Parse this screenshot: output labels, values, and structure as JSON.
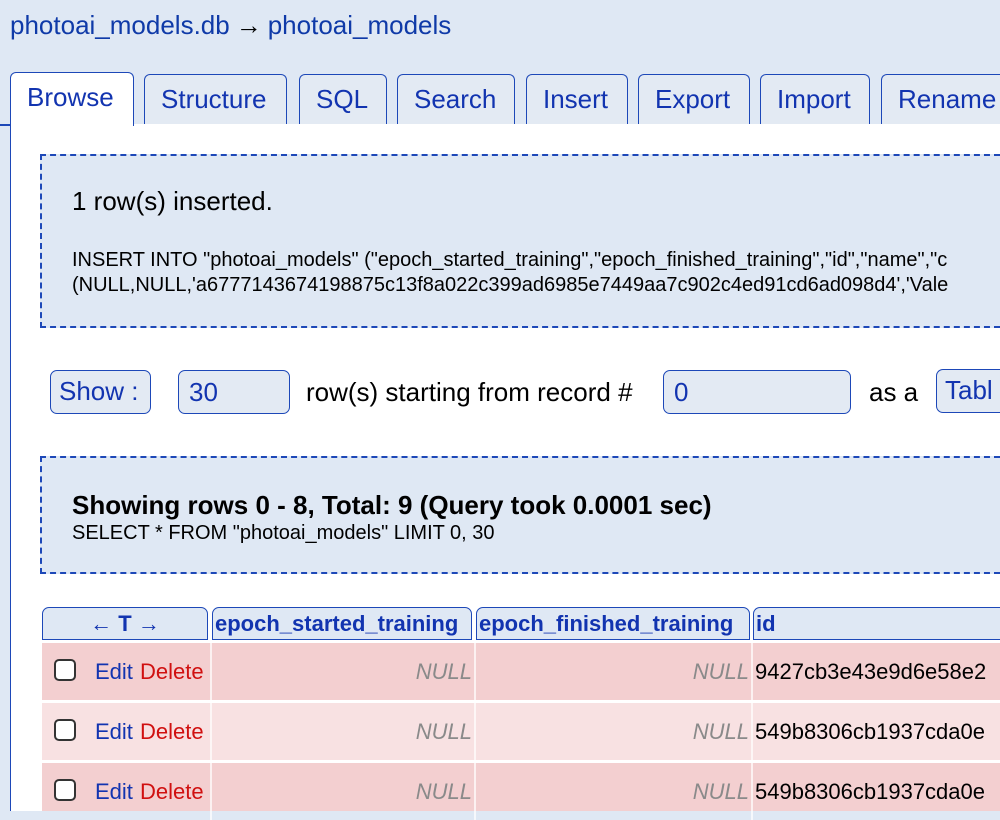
{
  "breadcrumb": {
    "database": "photoai_models.db",
    "arrow": "→",
    "table": "photoai_models"
  },
  "tabs": [
    {
      "label": "Browse",
      "active": true
    },
    {
      "label": "Structure"
    },
    {
      "label": "SQL"
    },
    {
      "label": "Search"
    },
    {
      "label": "Insert"
    },
    {
      "label": "Export"
    },
    {
      "label": "Import"
    },
    {
      "label": "Rename"
    }
  ],
  "insert_message": {
    "title": "1 row(s) inserted.",
    "sql_line1": "INSERT INTO \"photoai_models\" (\"epoch_started_training\",\"epoch_finished_training\",\"id\",\"name\",\"c",
    "sql_line2": "(NULL,NULL,'a6777143674198875c13f8a022c399ad6985e7449aa7c902c4ed91cd6ad098d4','Vale"
  },
  "controls": {
    "show_label": "Show :",
    "rows_value": "30",
    "rows_text": "row(s) starting from record #",
    "start_value": "0",
    "as_a_text": "as a",
    "mode_label": "Tabl"
  },
  "results_message": {
    "title": "Showing rows 0 - 8, Total: 9 (Query took 0.0001 sec)",
    "sql": "SELECT * FROM \"photoai_models\" LIMIT 0, 30"
  },
  "table": {
    "headers": {
      "nav": "← T →",
      "epoch_started": "epoch_started_training",
      "epoch_finished": "epoch_finished_training",
      "id": "id"
    },
    "rows": [
      {
        "edit": "Edit",
        "delete": "Delete",
        "epoch_started": "NULL",
        "epoch_finished": "NULL",
        "id": "9427cb3e43e9d6e58e2"
      },
      {
        "edit": "Edit",
        "delete": "Delete",
        "epoch_started": "NULL",
        "epoch_finished": "NULL",
        "id": "549b8306cb1937cda0e"
      },
      {
        "edit": "Edit",
        "delete": "Delete",
        "epoch_started": "NULL",
        "epoch_finished": "NULL",
        "id": "549b8306cb1937cda0e"
      }
    ]
  },
  "colors": {
    "link_blue": "#1234b0",
    "delete_red": "#d01010",
    "row_odd": "#f3cfd0",
    "row_even": "#f8e1e2",
    "panel_bg": "#dfe8f4"
  }
}
